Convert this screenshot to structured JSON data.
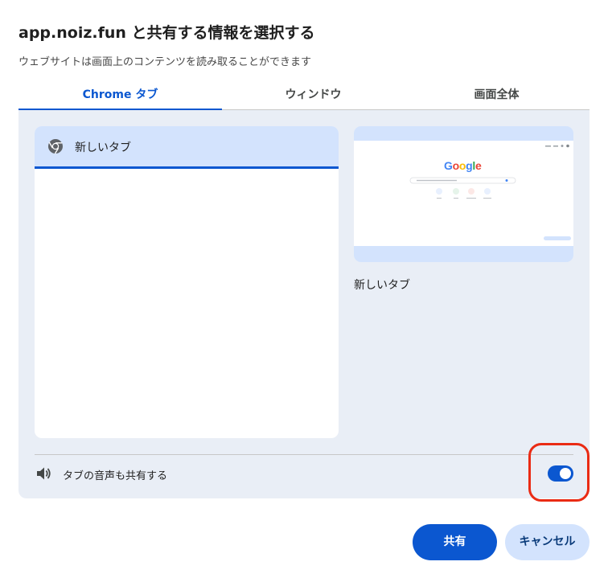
{
  "dialog": {
    "title": "app.noiz.fun と共有する情報を選択する",
    "subtitle": "ウェブサイトは画面上のコンテンツを読み取ることができます"
  },
  "tabs": [
    {
      "label": "Chrome タブ",
      "active": true
    },
    {
      "label": "ウィンドウ",
      "active": false
    },
    {
      "label": "画面全体",
      "active": false
    }
  ],
  "tab_list": {
    "items": [
      {
        "label": "新しいタブ",
        "icon": "chrome-icon",
        "selected": true
      }
    ]
  },
  "preview": {
    "label": "新しいタブ",
    "thumbnail": {
      "logo_text": "Google",
      "logo_colors": [
        "#4285f4",
        "#ea4335",
        "#fbbc05",
        "#4285f4",
        "#34a853",
        "#ea4335"
      ]
    }
  },
  "audio": {
    "label": "タブの音声も共有する",
    "icon": "speaker-icon",
    "enabled": true
  },
  "buttons": {
    "share": "共有",
    "cancel": "キャンセル"
  },
  "colors": {
    "accent": "#0b57d0",
    "panel_bg": "#e9eef6",
    "selected_bg": "#d3e3fd",
    "highlight": "#ea2b14"
  }
}
